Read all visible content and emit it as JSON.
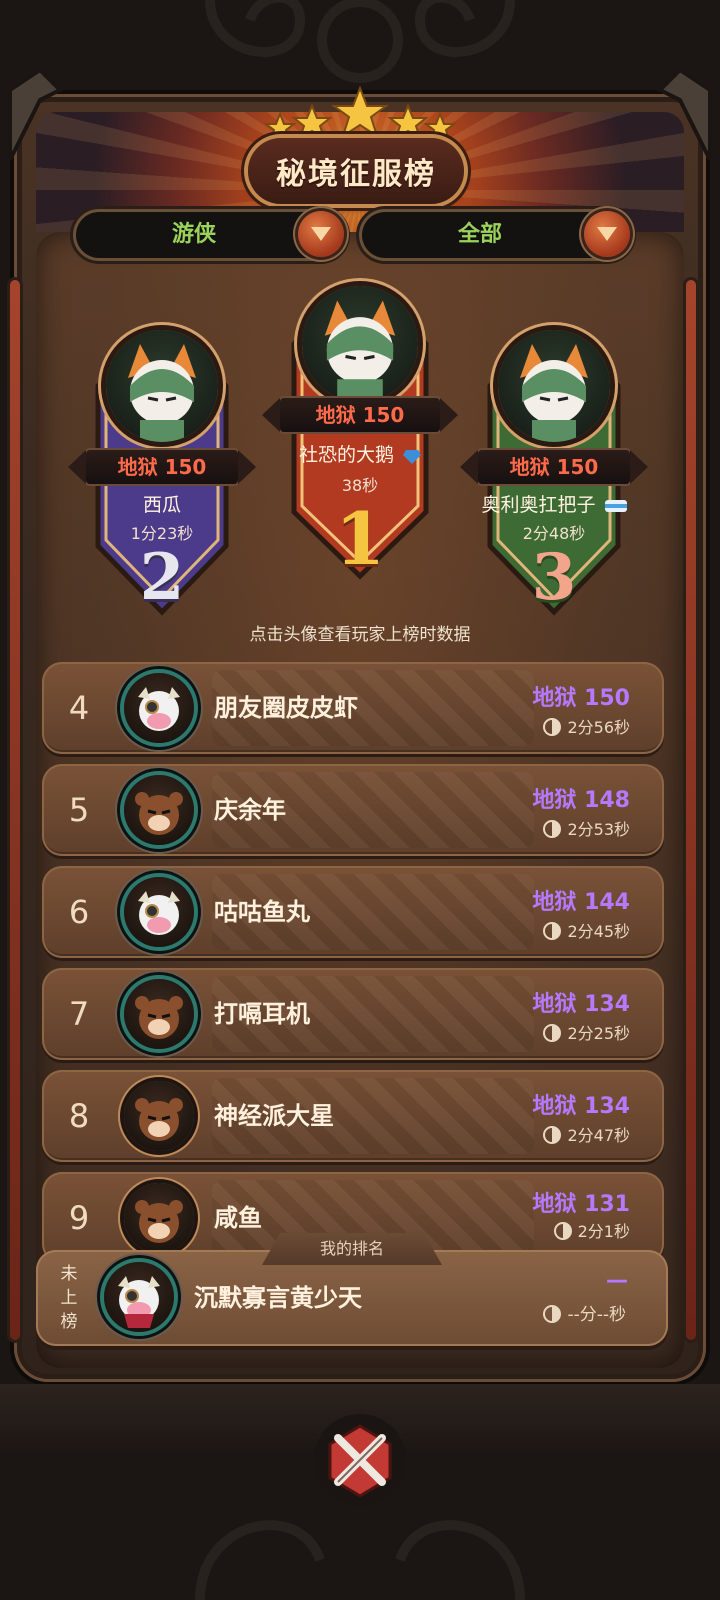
{
  "header": {
    "title": "秘境征服榜",
    "stars": 5
  },
  "filters": {
    "class_label": "游侠",
    "scope_label": "全部"
  },
  "podium": [
    {
      "rank": "1",
      "level": "地狱 150",
      "name": "社恐的大鹅",
      "time": "38秒",
      "badge": "blue-gem-icon"
    },
    {
      "rank": "2",
      "level": "地狱 150",
      "name": "西瓜",
      "time": "1分23秒",
      "badge": ""
    },
    {
      "rank": "3",
      "level": "地狱 150",
      "name": "奥利奥扛把子",
      "time": "2分48秒",
      "badge": "id-card-icon"
    }
  ],
  "hint": "点击头像查看玩家上榜时数据",
  "rows": [
    {
      "rank": "4",
      "name": "朋友圈皮皮虾",
      "level": "地狱 150",
      "time": "2分56秒",
      "avatar": "cow-avatar"
    },
    {
      "rank": "5",
      "name": "庆余年",
      "level": "地狱 148",
      "time": "2分53秒",
      "avatar": "bear-avatar"
    },
    {
      "rank": "6",
      "name": "咕咕鱼丸",
      "level": "地狱 144",
      "time": "2分45秒",
      "avatar": "cow-avatar"
    },
    {
      "rank": "7",
      "name": "打嗝耳机",
      "level": "地狱 134",
      "time": "2分25秒",
      "avatar": "bear-avatar"
    },
    {
      "rank": "8",
      "name": "神经派大星",
      "level": "地狱 134",
      "time": "2分47秒",
      "avatar": "bear-avatar"
    },
    {
      "rank": "9",
      "name": "咸鱼",
      "level": "地狱 131",
      "time": "2分1秒",
      "avatar": "bear-avatar"
    }
  ],
  "my_rank": {
    "tab_label": "我的排名",
    "status": "未上榜",
    "name": "沉默寡言黄少天",
    "level": "—",
    "time": "--分--秒"
  },
  "colors": {
    "level_purple": "#b579ff",
    "level_red": "#ff6a4a",
    "filter_green": "#9bd25a",
    "gold": "#f5c542"
  }
}
